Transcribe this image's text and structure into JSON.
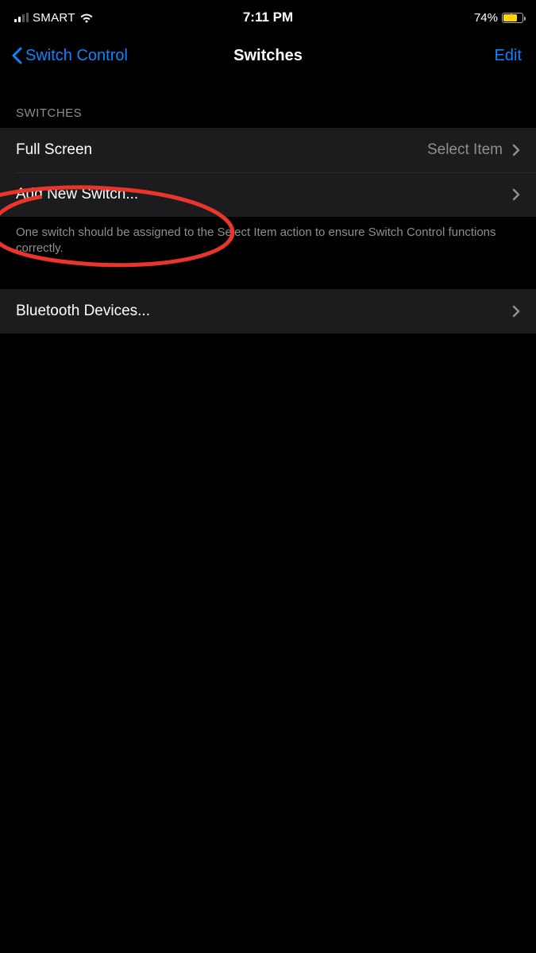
{
  "status": {
    "carrier": "SMART",
    "time": "7:11 PM",
    "battery_pct": "74%"
  },
  "nav": {
    "back_label": "Switch Control",
    "title": "Switches",
    "edit_label": "Edit"
  },
  "section1": {
    "header": "SWITCHES",
    "row1_label": "Full Screen",
    "row1_value": "Select Item",
    "row2_label": "Add New Switch...",
    "footer": "One switch should be assigned to the Select Item action to ensure Switch Control functions correctly."
  },
  "section2": {
    "row1_label": "Bluetooth Devices..."
  }
}
